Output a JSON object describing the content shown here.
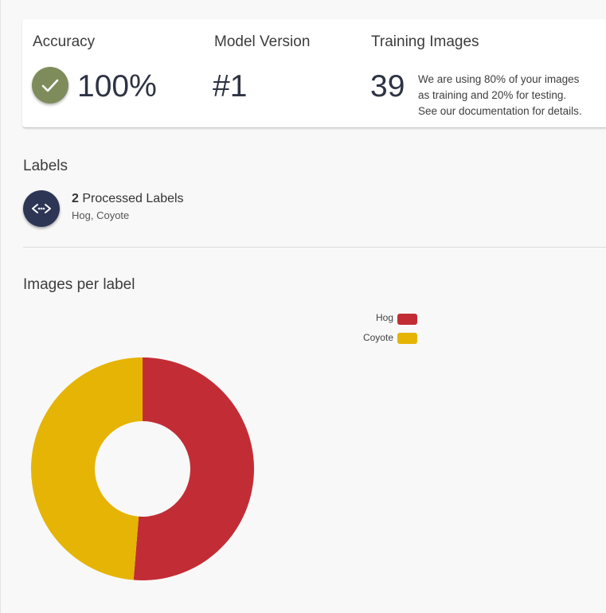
{
  "stats": {
    "accuracy": {
      "title": "Accuracy",
      "value": "100%",
      "icon": "checkmark-icon",
      "color": "#7e8c5c"
    },
    "model_version": {
      "title": "Model Version",
      "value": "#1"
    },
    "training_images": {
      "title": "Training Images",
      "value": "39",
      "note_lines": [
        "We are using 80% of your images",
        "as training and 20% for testing.",
        "See our documentation for details."
      ]
    }
  },
  "labels_section": {
    "title": "Labels",
    "icon": "labels-icon",
    "count": "2",
    "count_suffix": "Processed Labels",
    "names": "Hog, Coyote"
  },
  "chart_section": {
    "title": "Images per label"
  },
  "chart_data": {
    "type": "pie",
    "variant": "doughnut",
    "categories": [
      "Hog",
      "Coyote"
    ],
    "values": [
      20,
      19
    ],
    "colors": [
      "#c22d35",
      "#e6b404"
    ],
    "legend_position": "top-right"
  }
}
